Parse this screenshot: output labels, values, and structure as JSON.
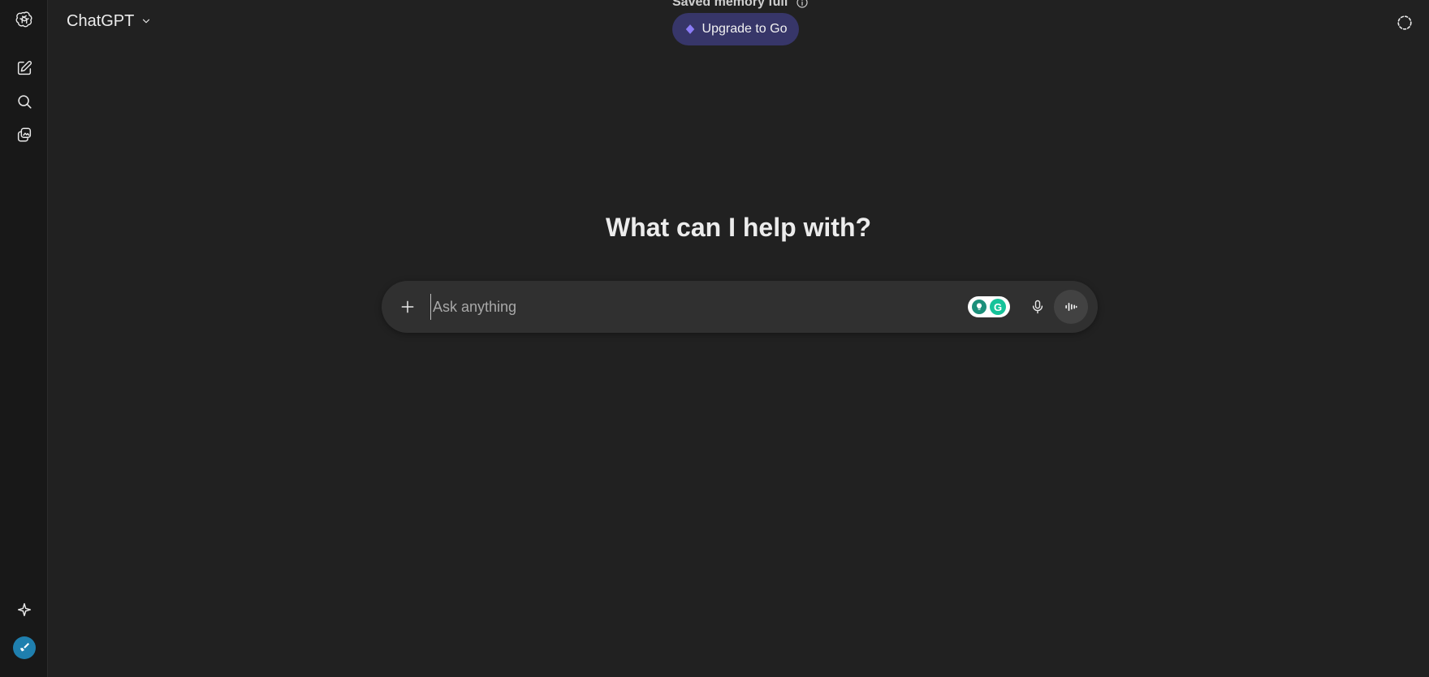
{
  "header": {
    "model_name": "ChatGPT",
    "memory_notice": "Saved memory full",
    "upgrade_label": "Upgrade to Go"
  },
  "sidebar": {
    "items": [
      {
        "icon": "logo-icon"
      },
      {
        "icon": "new-chat-icon"
      },
      {
        "icon": "search-icon"
      },
      {
        "icon": "library-icon"
      },
      {
        "icon": "sparkle-icon"
      },
      {
        "icon": "avatar"
      }
    ]
  },
  "main": {
    "headline": "What can I help with?",
    "composer": {
      "placeholder": "Ask anything",
      "value": ""
    }
  },
  "colors": {
    "background": "#212121",
    "sidebar": "#181818",
    "composer": "#303030",
    "upgrade_pill": "#373669",
    "upgrade_diamond": "#8b7cf6",
    "avatar": "#1f7fae",
    "grammarly": "#15c39a"
  }
}
